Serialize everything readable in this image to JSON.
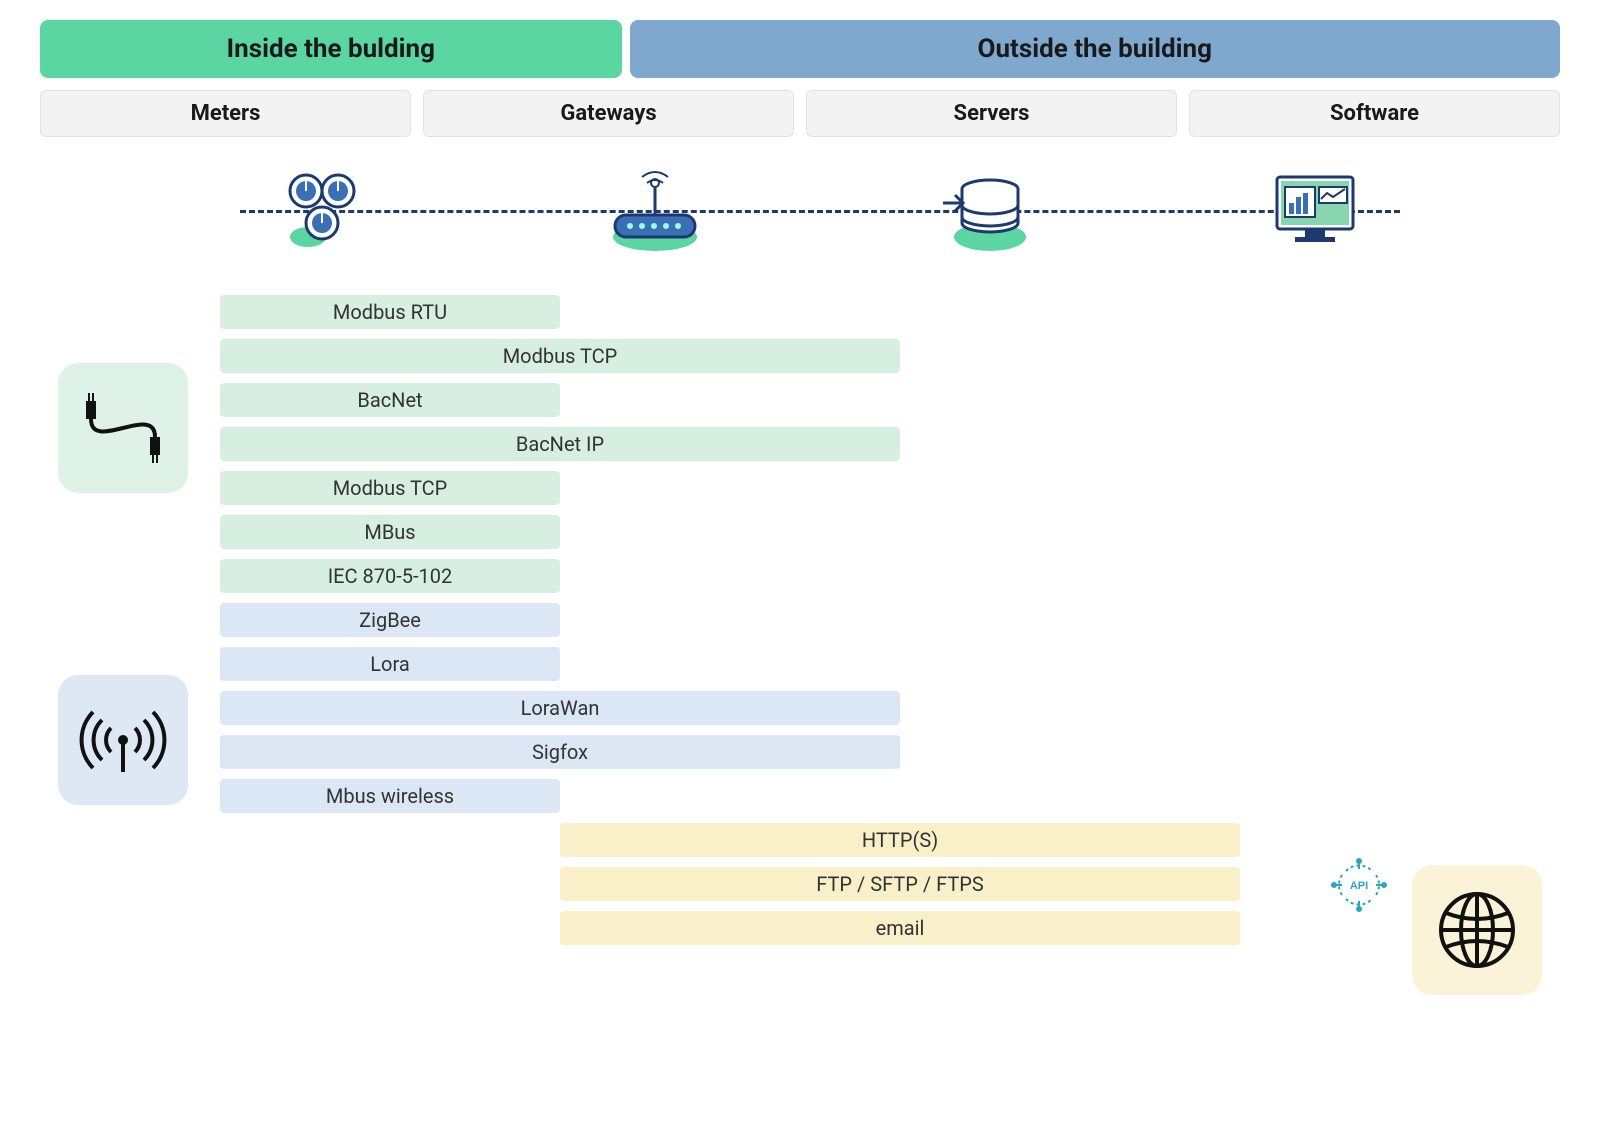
{
  "top": {
    "inside": "Inside the bulding",
    "outside": "Outside the building"
  },
  "columns": [
    "Meters",
    "Gateways",
    "Servers",
    "Software"
  ],
  "wired_protocols": [
    {
      "label": "Modbus RTU",
      "span": 1,
      "color": "green"
    },
    {
      "label": "Modbus TCP",
      "span": 2,
      "color": "green"
    },
    {
      "label": "BacNet",
      "span": 1,
      "color": "green"
    },
    {
      "label": "BacNet IP",
      "span": 2,
      "color": "green"
    },
    {
      "label": "Modbus TCP",
      "span": 1,
      "color": "green"
    },
    {
      "label": "MBus",
      "span": 1,
      "color": "green"
    },
    {
      "label": "IEC 870-5-102",
      "span": 1,
      "color": "green"
    }
  ],
  "wireless_protocols": [
    {
      "label": "ZigBee",
      "span": 1,
      "color": "blue"
    },
    {
      "label": "Lora",
      "span": 1,
      "color": "blue"
    },
    {
      "label": "LoraWan",
      "span": 2,
      "color": "blue"
    },
    {
      "label": "Sigfox",
      "span": 2,
      "color": "blue"
    },
    {
      "label": "Mbus wireless",
      "span": 1,
      "color": "blue"
    }
  ],
  "network_protocols": [
    {
      "label": "HTTP(S)",
      "span": 2,
      "color": "yellow"
    },
    {
      "label": "FTP / SFTP / FTPS",
      "span": 2,
      "color": "yellow"
    },
    {
      "label": "email",
      "span": 2,
      "color": "yellow"
    }
  ],
  "api_label": "API"
}
